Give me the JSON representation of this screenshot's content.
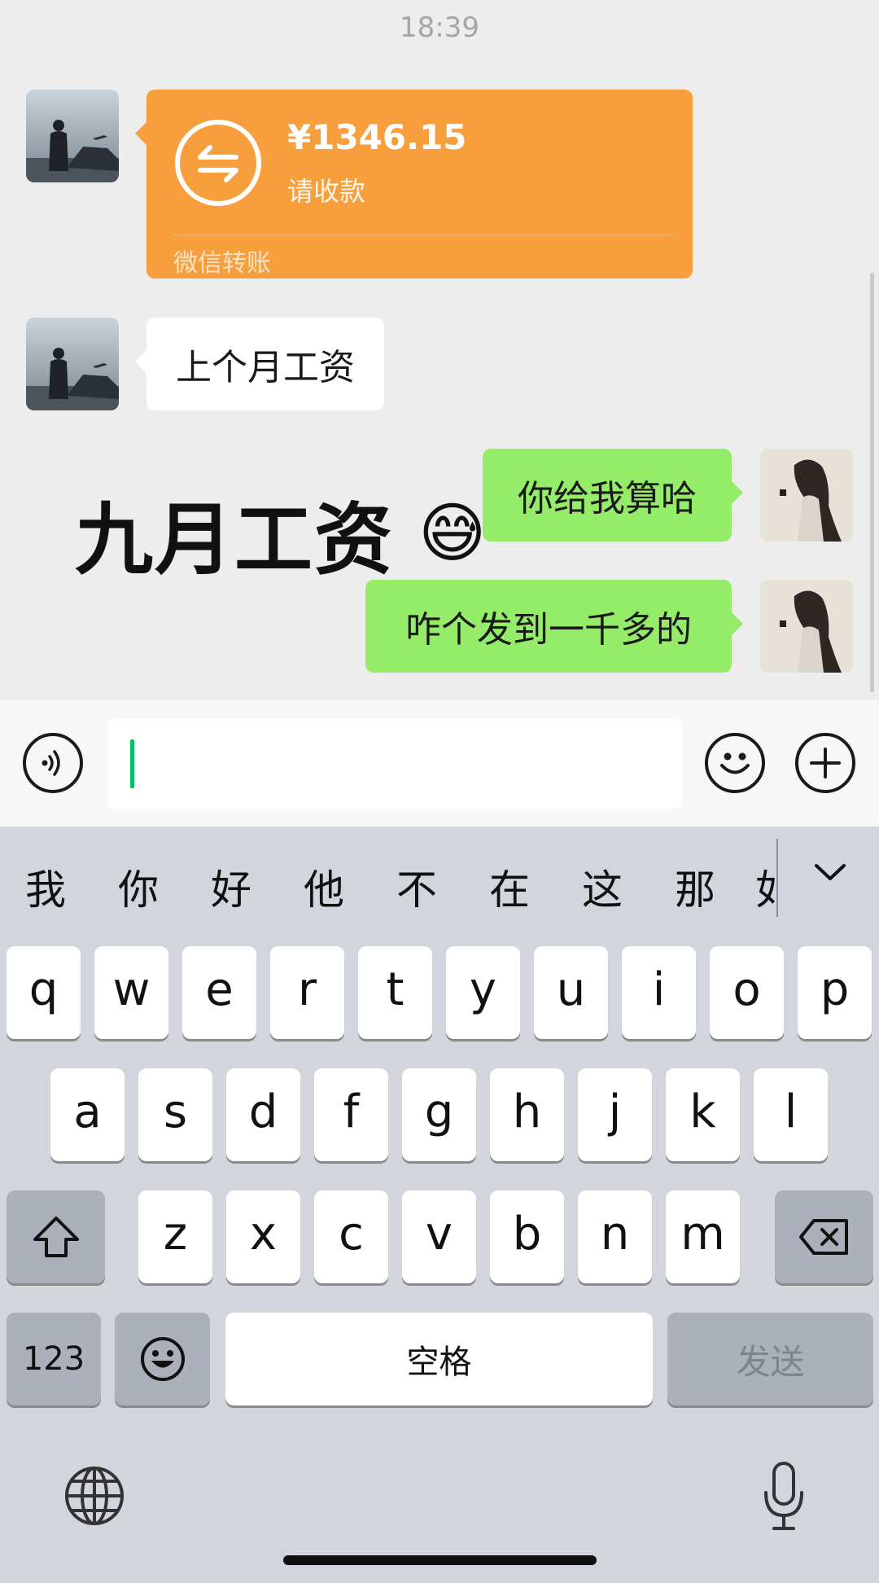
{
  "status": {
    "time": "18:39"
  },
  "chat": {
    "transfer": {
      "amount": "¥1346.15",
      "status": "请收款",
      "source": "微信转账"
    },
    "messages": [
      {
        "from": "other",
        "text": "上个月工资"
      },
      {
        "from": "me",
        "text": "你给我算哈"
      },
      {
        "from": "me",
        "text": "咋个发到一千多的"
      }
    ],
    "overlay_caption": "九月工资",
    "overlay_emoji": "😅"
  },
  "input_bar": {
    "value": ""
  },
  "keyboard": {
    "candidates": [
      "我",
      "你",
      "好",
      "他",
      "不",
      "在",
      "这",
      "那",
      "如"
    ],
    "row1": [
      "q",
      "w",
      "e",
      "r",
      "t",
      "y",
      "u",
      "i",
      "o",
      "p"
    ],
    "row2": [
      "a",
      "s",
      "d",
      "f",
      "g",
      "h",
      "j",
      "k",
      "l"
    ],
    "row3": [
      "z",
      "x",
      "c",
      "v",
      "b",
      "n",
      "m"
    ],
    "numbers_label": "123",
    "space_label": "空格",
    "send_label": "发送"
  },
  "colors": {
    "transfer": "#f79e3d",
    "my_bubble": "#95ec69",
    "caret": "#07c160"
  },
  "icons": [
    "voice-icon",
    "emoji-icon",
    "plus-icon",
    "transfer-icon",
    "shift-icon",
    "delete-icon",
    "emoji-key-icon",
    "globe-icon",
    "mic-icon",
    "chevron-down-icon"
  ]
}
